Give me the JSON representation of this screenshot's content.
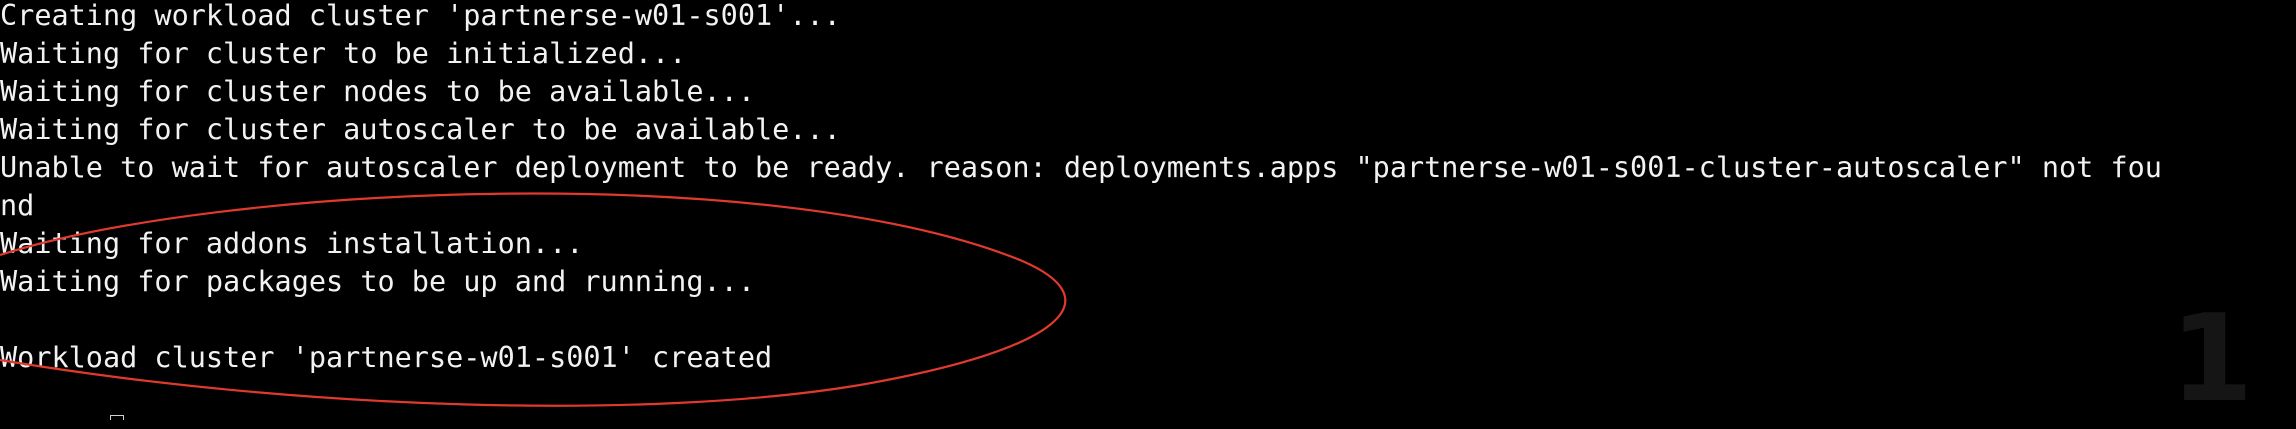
{
  "terminal": {
    "lines": [
      "Creating workload cluster 'partnerse-w01-s001'...",
      "Waiting for cluster to be initialized...",
      "Waiting for cluster nodes to be available...",
      "Waiting for cluster autoscaler to be available...",
      "Unable to wait for autoscaler deployment to be ready. reason: deployments.apps \"partnerse-w01-s001-cluster-autoscaler\" not fou",
      "nd",
      "Waiting for addons installation...",
      "Waiting for packages to be up and running...",
      "",
      "Workload cluster 'partnerse-w01-s001' created"
    ]
  },
  "watermark": {
    "text": "1"
  },
  "annotation": {
    "shape": "ellipse",
    "color": "#e03a2e"
  }
}
